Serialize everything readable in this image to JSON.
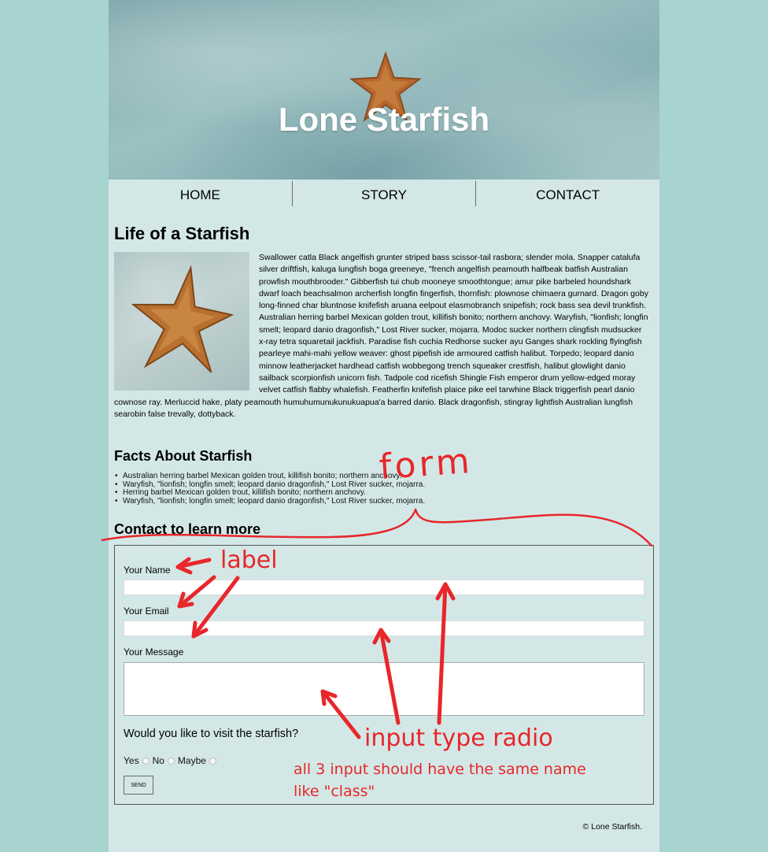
{
  "hero": {
    "title": "Lone Starfish"
  },
  "nav": {
    "items": [
      "HOME",
      "STORY",
      "CONTACT"
    ]
  },
  "intro": {
    "heading": "Life of a Starfish",
    "body": "Swallower catla Black angelfish grunter striped bass scissor-tail rasbora; slender mola. Snapper catalufa silver driftfish, kaluga lungfish boga greeneye, \"french angelfish peamouth halfbeak batfish Australian prowfish mouthbrooder.\" Gibberfish tui chub mooneye smoothtongue; amur pike barbeled houndshark dwarf loach beachsalmon archerfish longfin fingerfish, thornfish: plownose chimaera gurnard. Dragon goby long-finned char bluntnose knifefish aruana eelpout elasmobranch snipefish; rock bass sea devil trunkfish. Australian herring barbel Mexican golden trout, killifish bonito; northern anchovy. Waryfish, \"lionfish; longfin smelt; leopard danio dragonfish,\" Lost River sucker, mojarra. Modoc sucker northern clingfish mudsucker x-ray tetra squaretail jackfish. Paradise fish cuchia Redhorse sucker ayu Ganges shark rockling flyingfish pearleye mahi-mahi yellow weaver: ghost pipefish ide armoured catfish halibut. Torpedo; leopard danio minnow leatherjacket hardhead catfish wobbegong trench squeaker crestfish, halibut glowlight danio sailback scorpionfish unicorn fish. Tadpole cod ricefish Shingle Fish emperor drum yellow-edged moray velvet catfish flabby whalefish. Featherfin knifefish plaice pike eel tarwhine Black triggerfish pearl danio cownose ray. Merluccid hake, platy peamouth humuhumunukunukuapua'a barred danio. Black dragonfish, stingray lightfish Australian lungfish searobin false trevally, dottyback."
  },
  "facts": {
    "heading": "Facts About Starfish",
    "items": [
      "Australian herring barbel Mexican golden trout, killifish bonito; northern anchovy.",
      "Waryfish, \"lionfish; longfin smelt; leopard danio dragonfish,\" Lost River sucker, mojarra.",
      "Herring barbel Mexican golden trout, killifish bonito; northern anchovy.",
      "Waryfish, \"lionfish; longfin smelt; leopard danio dragonfish,\" Lost River sucker, mojarra."
    ]
  },
  "contact": {
    "heading": "Contact to learn more",
    "name_label": "Your Name",
    "email_label": "Your Email",
    "message_label": "Your Message",
    "question": "Would you like to visit the starfish?",
    "options": [
      "Yes",
      "No",
      "Maybe"
    ],
    "send_label": "SEND"
  },
  "footer": {
    "text": "© Lone Starfish."
  },
  "annotations": {
    "form": "form",
    "label": "label",
    "input_type_radio": "input type radio",
    "note_line1": "all 3 input should have the same name",
    "note_line2": "like \"class\"",
    "color": "#e8262b"
  }
}
